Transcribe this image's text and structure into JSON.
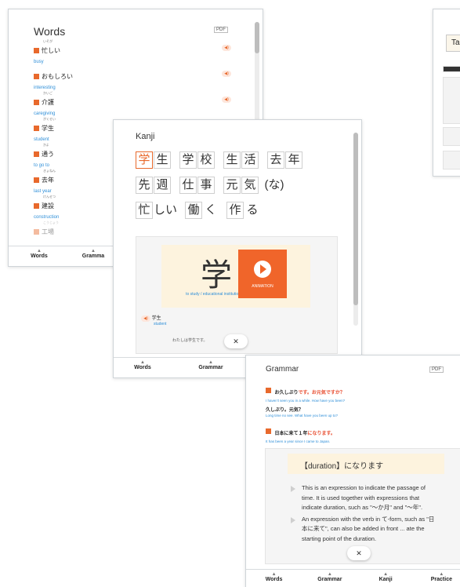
{
  "words_panel": {
    "title": "Words",
    "pdf_label": "PDF",
    "items": [
      {
        "ruby": "いそが",
        "jp": "忙しい",
        "en": "busy"
      },
      {
        "ruby": "",
        "jp": "おもしろい",
        "en": "interesting"
      },
      {
        "ruby": "かいご",
        "jp": "介護",
        "en": "caregiving"
      },
      {
        "ruby": "がくせい",
        "jp": "学生",
        "en": "student"
      },
      {
        "ruby": "かよ",
        "jp": "通う",
        "en": "to go to"
      },
      {
        "ruby": "きょねん",
        "jp": "去年",
        "en": "last year"
      },
      {
        "ruby": "けんせつ",
        "jp": "建設",
        "en": "construction"
      },
      {
        "ruby": "こうじょう",
        "jp": "工場",
        "en": ""
      }
    ],
    "nav": {
      "words": "Words",
      "grammar": "Gramma"
    }
  },
  "test_panel": {
    "title": "Ta"
  },
  "kanji_panel": {
    "title": "Kanji",
    "row1": [
      "学",
      "生",
      "学",
      "校",
      "生",
      "活",
      "去",
      "年"
    ],
    "row2": [
      "先",
      "週",
      "仕",
      "事",
      "元",
      "気",
      "(な)"
    ],
    "row3_a": [
      "忙",
      "しい"
    ],
    "row3_b": [
      "働",
      "く"
    ],
    "row3_c": [
      "作",
      "る"
    ],
    "card": {
      "kanji": "学",
      "meaning": "to study / educational institution",
      "animation_label": "ANIMATION",
      "word": "学生",
      "word_en": "student",
      "sentence": "わたしは学生です。"
    },
    "close_label": "✕",
    "nav": {
      "words": "Words",
      "grammar": "Grammar"
    }
  },
  "grammar_panel": {
    "title": "Grammar",
    "pdf_label": "PDF",
    "entry1": {
      "jp_a": "お久しぶり",
      "jp_b": "です。お元気",
      "jp_c": "ですか？",
      "en1": "I haven't seen you in a while. How have you been?",
      "jp2": "久しぶり。元気？",
      "en2": "Long time no see. What have you been up to?"
    },
    "entry2": {
      "jp_a": "日本に来て１年",
      "jp_b": "になります。",
      "en": "It has been a year since I came to Japan."
    },
    "card": {
      "heading": "【duration】になります",
      "bullet1": "This is an expression to indicate the passage of time. It is used together with expressions that indicate duration, such as \"〜か月\" and \"〜年\".",
      "bullet2": "An expression with the verb in て-form, such as \"日本に来て\", can also be added in front ... ate the starting point of the duration."
    },
    "close_label": "✕",
    "nav": {
      "words": "Words",
      "grammar": "Grammar",
      "kanji": "Kanji",
      "practice": "Practice"
    }
  }
}
